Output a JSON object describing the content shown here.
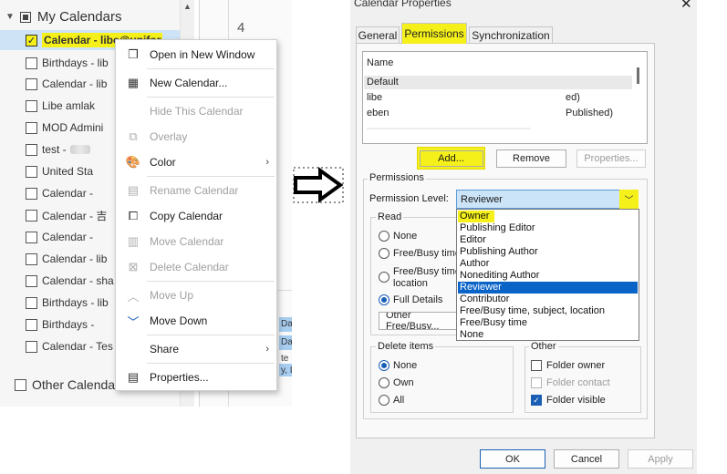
{
  "folder_pane": {
    "my_calendars_label": "My Calendars",
    "other_calendars_label": "Other Calendars",
    "day_number": "4",
    "items": [
      {
        "label": "Calendar - libe@unifor",
        "checked": true
      },
      {
        "label": "Birthdays - lib"
      },
      {
        "label": "Calendar - lib"
      },
      {
        "label": "Libe amlak"
      },
      {
        "label": "MOD Admini"
      },
      {
        "label": "test -"
      },
      {
        "label": "United Sta"
      },
      {
        "label": "Calendar -"
      },
      {
        "label": "Calendar - 吉"
      },
      {
        "label": "Calendar -"
      },
      {
        "label": "Calendar - lib"
      },
      {
        "label": "Calendar - sha"
      },
      {
        "label": "Birthdays - lib"
      },
      {
        "label": "Birthdays -"
      },
      {
        "label": "Calendar - Tes"
      }
    ],
    "events": [
      "Da",
      "Da",
      "te",
      "y, L"
    ]
  },
  "context_menu": {
    "items": [
      {
        "label": "Open in New Window",
        "icon": "open-window-icon",
        "enabled": true
      },
      {
        "label": "New Calendar...",
        "icon": "new-calendar-icon",
        "enabled": true
      },
      {
        "label": "Hide This Calendar",
        "icon": "",
        "enabled": false
      },
      {
        "label": "Overlay",
        "icon": "overlay-icon",
        "enabled": false
      },
      {
        "label": "Color",
        "icon": "palette-icon",
        "enabled": true,
        "submenu": true
      },
      {
        "label": "Rename Calendar",
        "icon": "rename-icon",
        "enabled": false
      },
      {
        "label": "Copy Calendar",
        "icon": "copy-calendar-icon",
        "enabled": true
      },
      {
        "label": "Move Calendar",
        "icon": "move-calendar-icon",
        "enabled": false
      },
      {
        "label": "Delete Calendar",
        "icon": "delete-calendar-icon",
        "enabled": false
      },
      {
        "label": "Move Up",
        "icon": "chevron-up-icon",
        "enabled": false
      },
      {
        "label": "Move Down",
        "icon": "chevron-down-icon",
        "enabled": true
      },
      {
        "label": "Share",
        "icon": "",
        "enabled": true,
        "submenu": true
      },
      {
        "label": "Properties...",
        "icon": "properties-icon",
        "enabled": true,
        "highlighted": true
      }
    ]
  },
  "dialog": {
    "title": "Calendar Properties",
    "tabs": [
      "General",
      "Permissions",
      "Synchronization"
    ],
    "active_tab": "Permissions",
    "user_list": {
      "header": "Name",
      "rows": [
        "Default",
        "libe",
        "ed)",
        "eben",
        "Published)"
      ]
    },
    "buttons": {
      "add": "Add...",
      "remove": "Remove",
      "properties": "Properties...",
      "ok": "OK",
      "cancel": "Cancel",
      "apply": "Apply"
    },
    "permissions_legend": "Permissions",
    "permission_level_label": "Permission Level:",
    "permission_level_value": "Reviewer",
    "read": {
      "legend": "Read",
      "options": [
        "None",
        "Free/Busy time",
        "Free/Busy time, subject, location",
        "Full Details"
      ],
      "free_busy_time_2": "location",
      "other_free_busy": "Other Free/Busy..."
    },
    "dropdown_options": [
      "Owner",
      "Publishing Editor",
      "Editor",
      "Publishing Author",
      "Author",
      "Nonediting Author",
      "Reviewer",
      "Contributor",
      "Free/Busy time, subject, location",
      "Free/Busy time",
      "None"
    ],
    "delete_items": {
      "legend": "Delete items",
      "options": [
        "None",
        "Own",
        "All"
      ]
    },
    "other": {
      "legend": "Other",
      "folder_owner": "Folder owner",
      "folder_contact": "Folder contact",
      "folder_visible": "Folder visible"
    }
  },
  "colors": {
    "highlight": "#f5f019",
    "selection": "#0a64c8",
    "accent": "#1a5fb4"
  }
}
